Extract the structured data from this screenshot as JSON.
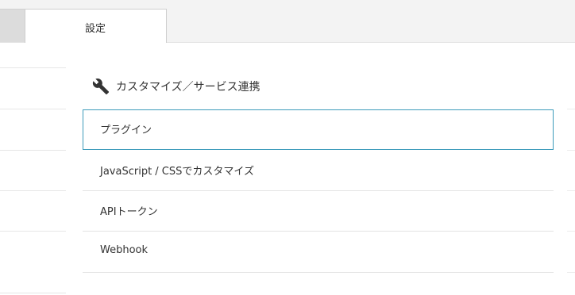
{
  "tabs": {
    "active_label": "設定"
  },
  "section": {
    "icon": "wrench-icon",
    "title": "カスタマイズ／サービス連携"
  },
  "menu": {
    "items": [
      {
        "label": "プラグイン",
        "selected": true
      },
      {
        "label": "JavaScript / CSSでカスタマイズ",
        "selected": false
      },
      {
        "label": "APIトークン",
        "selected": false
      },
      {
        "label": "Webhook",
        "selected": false
      }
    ]
  },
  "colors": {
    "selected_border": "#3d9bbb",
    "tabbar_bg": "#f3f3f3",
    "text": "#333333"
  }
}
